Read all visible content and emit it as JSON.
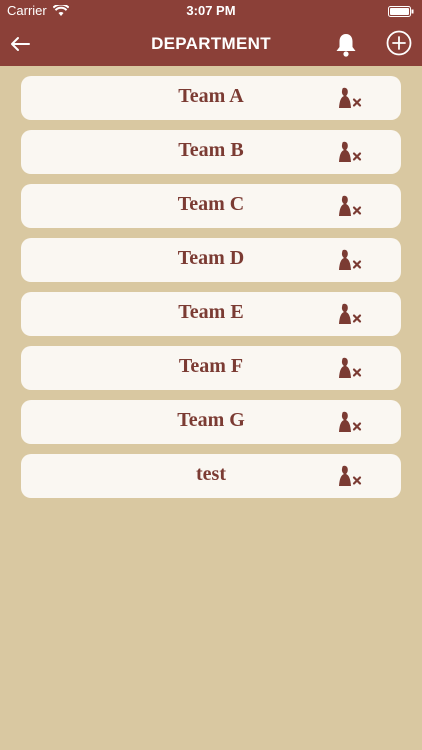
{
  "status_bar": {
    "carrier": "Carrier",
    "time": "3:07 PM"
  },
  "header": {
    "title": "DEPARTMENT",
    "icons": [
      "back-arrow-icon",
      "bell-icon",
      "add-circle-icon"
    ]
  },
  "departments": [
    {
      "name": "Team A"
    },
    {
      "name": "Team B"
    },
    {
      "name": "Team C"
    },
    {
      "name": "Team D"
    },
    {
      "name": "Team E"
    },
    {
      "name": "Team F"
    },
    {
      "name": "Team G"
    },
    {
      "name": "test"
    }
  ],
  "colors": {
    "header_bg": "#8b4038",
    "page_bg": "#d9c8a1",
    "card_bg": "#faf7f2",
    "text": "#7b3b33"
  }
}
